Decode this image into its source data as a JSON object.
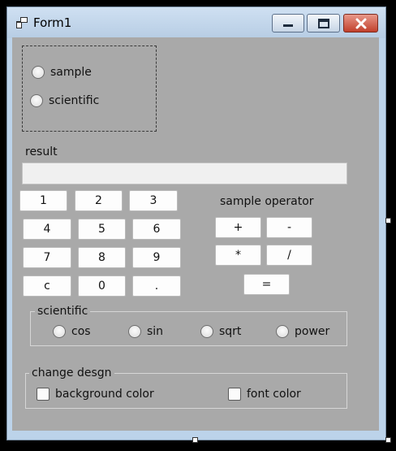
{
  "window": {
    "title": "Form1",
    "controls": {
      "minimize": "minimize",
      "maximize": "maximize",
      "close": "close"
    }
  },
  "mode_group": {
    "options": [
      {
        "label": "sample",
        "checked": false
      },
      {
        "label": "scientific",
        "checked": false
      }
    ]
  },
  "result": {
    "label": "result",
    "value": ""
  },
  "keypad": [
    "1",
    "2",
    "3",
    "4",
    "5",
    "6",
    "7",
    "8",
    "9",
    "c",
    "0",
    "."
  ],
  "sample_operator": {
    "label": "sample operator",
    "buttons": [
      "+",
      "-",
      "*",
      "/",
      "="
    ]
  },
  "scientific_group": {
    "title": "scientific",
    "options": [
      "cos",
      "sin",
      "sqrt",
      "power"
    ]
  },
  "design_group": {
    "title": "change desgn",
    "options": [
      "background color",
      "font color"
    ]
  }
}
